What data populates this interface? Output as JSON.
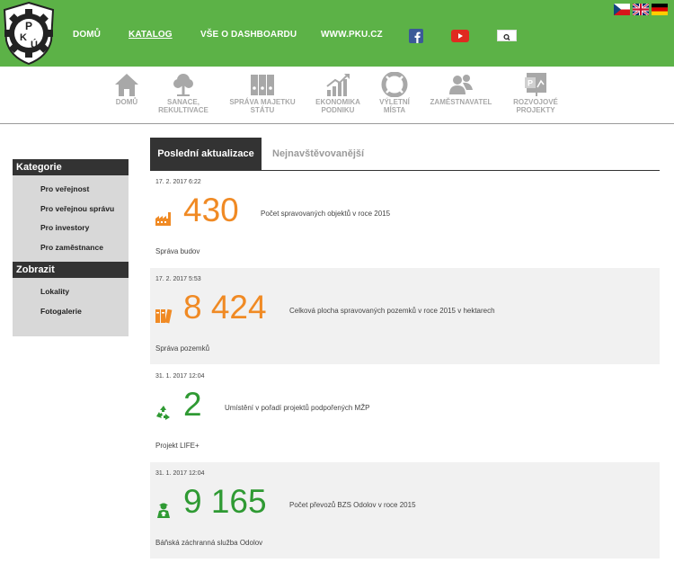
{
  "header": {
    "logo_text": "PKÚ",
    "nav": [
      {
        "label": "DOMŮ",
        "active": false
      },
      {
        "label": "KATALOG",
        "active": true
      },
      {
        "label": "VŠE O DASHBOARDU",
        "active": false
      },
      {
        "label": "WWW.PKU.CZ",
        "active": false
      }
    ],
    "social": [
      "facebook-icon",
      "youtube-icon"
    ],
    "search_icon": "search-icon",
    "languages": [
      "cs",
      "en",
      "de"
    ],
    "colors": {
      "header_bg": "#5cb247",
      "orange": "#f08a24",
      "green": "#2f9a33"
    }
  },
  "iconbar": [
    {
      "lines": [
        "DOMŮ"
      ],
      "icon": "house-icon"
    },
    {
      "lines": [
        "SANACE,",
        "REKULTIVACE"
      ],
      "icon": "tree-icon"
    },
    {
      "lines": [
        "SPRÁVA MAJETKU",
        "STÁTU"
      ],
      "icon": "binders-icon"
    },
    {
      "lines": [
        "EKONOMIKA",
        "PODNIKU"
      ],
      "icon": "chart-icon"
    },
    {
      "lines": [
        "VÝLETNÍ",
        "MÍSTA"
      ],
      "icon": "lifebuoy-icon"
    },
    {
      "lines": [
        "ZAMĚSTNAVATEL"
      ],
      "icon": "people-icon"
    },
    {
      "lines": [
        "ROZVOJOVÉ",
        "PROJEKTY"
      ],
      "icon": "presentation-icon"
    }
  ],
  "sidebar": {
    "kategorie_title": "Kategorie",
    "kategorie": [
      "Pro veřejnost",
      "Pro veřejnou správu",
      "Pro investory",
      "Pro zaměstnance"
    ],
    "zobrazit_title": "Zobrazit",
    "zobrazit": [
      "Lokality",
      "Fotogalerie"
    ]
  },
  "tabs": {
    "active": "Poslední aktualizace",
    "inactive": "Nejnavštěvovanější"
  },
  "entries": [
    {
      "date": "17. 2. 2017 6:22",
      "value": "430",
      "description": "Počet spravovaných objektů v roce 2015",
      "category": "Správa budov",
      "color": "#f08a24",
      "icon": "factory-icon"
    },
    {
      "date": "17. 2. 2017 5:53",
      "value": "8 424",
      "description": "Celková plocha spravovaných pozemků v roce 2015 v hektarech",
      "category": "Správa pozemků",
      "color": "#f08a24",
      "icon": "books-icon"
    },
    {
      "date": "31. 1. 2017 12:04",
      "value": "2",
      "description": "Umístění v pořadí projektů podpořených MŽP",
      "category": "Projekt LIFE+",
      "color": "#2f9a33",
      "icon": "recycle-icon"
    },
    {
      "date": "31. 1. 2017 12:04",
      "value": "9 165",
      "description": "Počet převozů BZS Odolov v roce 2015",
      "category": "Báňská záchranná služba Odolov",
      "color": "#2f9a33",
      "icon": "rescuer-icon"
    }
  ]
}
